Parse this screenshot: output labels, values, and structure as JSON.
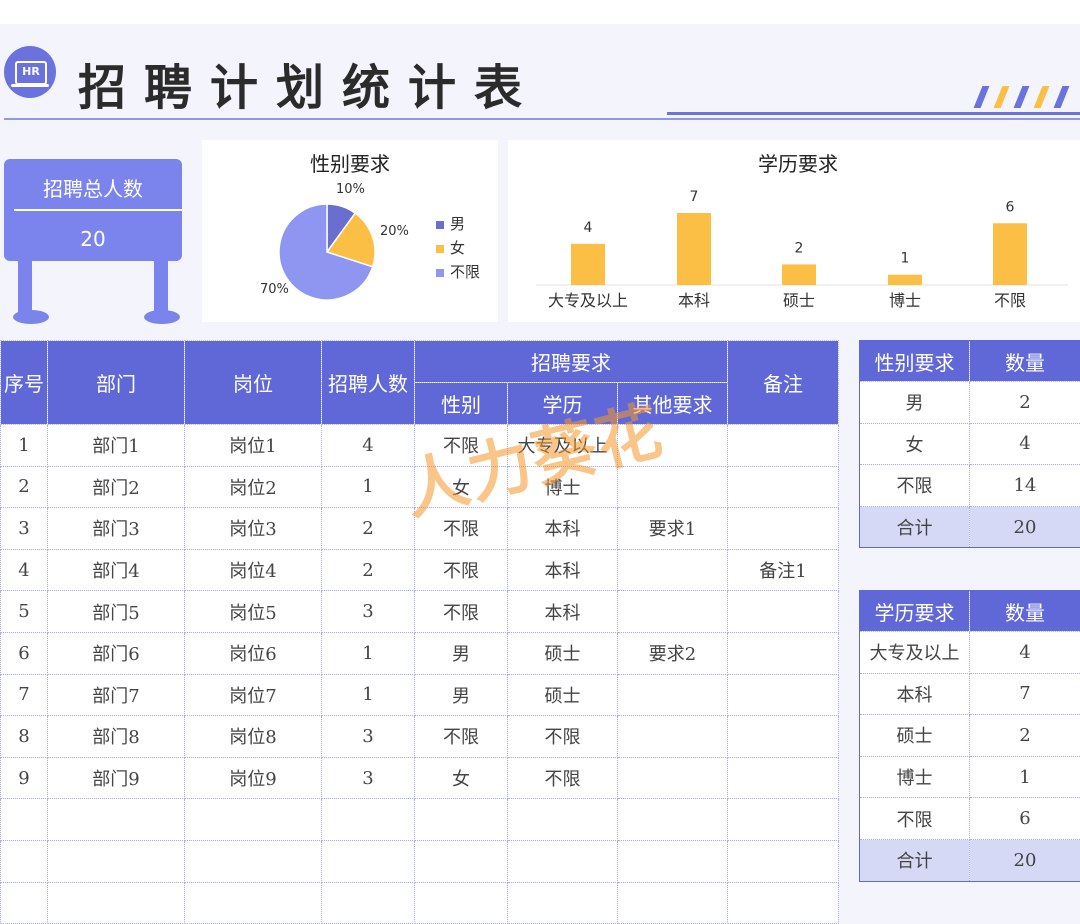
{
  "header": {
    "logo_text": "HR",
    "title": "招聘计划统计表"
  },
  "colors": {
    "accent": "#6068d8",
    "brand_light": "#7b83ec",
    "bar": "#fbbf45",
    "pie_male": "#6a6fcf",
    "pie_female": "#fbbf45",
    "pie_any": "#8e96f2",
    "watermark": "#f59628"
  },
  "summary": {
    "label": "招聘总人数",
    "value": "20"
  },
  "gender_chart": {
    "title": "性别要求",
    "slices": [
      {
        "label": "男",
        "value": 10,
        "pct_label": "10%"
      },
      {
        "label": "女",
        "value": 20,
        "pct_label": "20%"
      },
      {
        "label": "不限",
        "value": 70,
        "pct_label": "70%"
      }
    ]
  },
  "chart_data": {
    "type": "bar",
    "title": "学历要求",
    "categories": [
      "大专及以上",
      "本科",
      "硕士",
      "博士",
      "不限"
    ],
    "values": [
      4,
      7,
      2,
      1,
      6
    ],
    "xlabel": "",
    "ylabel": "",
    "grid": false
  },
  "main_table": {
    "headers": {
      "index": "序号",
      "dept": "部门",
      "position": "岗位",
      "count": "招聘人数",
      "req_group": "招聘要求",
      "gender": "性别",
      "edu": "学历",
      "other": "其他要求",
      "note": "备注"
    },
    "rows": [
      [
        "1",
        "部门1",
        "岗位1",
        "4",
        "不限",
        "大专及以上",
        "",
        ""
      ],
      [
        "2",
        "部门2",
        "岗位2",
        "1",
        "女",
        "博士",
        "",
        ""
      ],
      [
        "3",
        "部门3",
        "岗位3",
        "2",
        "不限",
        "本科",
        "要求1",
        ""
      ],
      [
        "4",
        "部门4",
        "岗位4",
        "2",
        "不限",
        "本科",
        "",
        "备注1"
      ],
      [
        "5",
        "部门5",
        "岗位5",
        "3",
        "不限",
        "本科",
        "",
        ""
      ],
      [
        "6",
        "部门6",
        "岗位6",
        "1",
        "男",
        "硕士",
        "要求2",
        ""
      ],
      [
        "7",
        "部门7",
        "岗位7",
        "1",
        "男",
        "硕士",
        "",
        ""
      ],
      [
        "8",
        "部门8",
        "岗位8",
        "3",
        "不限",
        "不限",
        "",
        ""
      ],
      [
        "9",
        "部门9",
        "岗位9",
        "3",
        "女",
        "不限",
        "",
        ""
      ],
      [
        "",
        "",
        "",
        "",
        "",
        "",
        "",
        ""
      ],
      [
        "",
        "",
        "",
        "",
        "",
        "",
        "",
        ""
      ],
      [
        "",
        "",
        "",
        "",
        "",
        "",
        "",
        ""
      ]
    ]
  },
  "gender_table": {
    "headers": [
      "性别要求",
      "数量"
    ],
    "rows": [
      [
        "男",
        "2"
      ],
      [
        "女",
        "4"
      ],
      [
        "不限",
        "14"
      ]
    ],
    "total": [
      "合计",
      "20"
    ]
  },
  "edu_table": {
    "headers": [
      "学历要求",
      "数量"
    ],
    "rows": [
      [
        "大专及以上",
        "4"
      ],
      [
        "本科",
        "7"
      ],
      [
        "硕士",
        "2"
      ],
      [
        "博士",
        "1"
      ],
      [
        "不限",
        "6"
      ]
    ],
    "total": [
      "合计",
      "20"
    ]
  },
  "watermark": "人力葵花"
}
